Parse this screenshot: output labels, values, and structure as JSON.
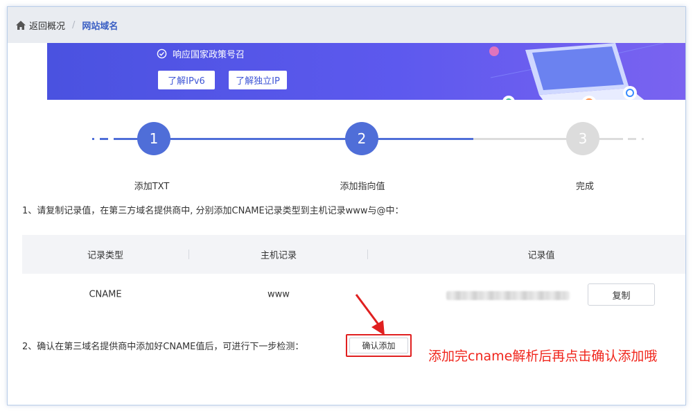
{
  "breadcrumb": {
    "back_label": "返回概况",
    "separator": "/",
    "current": "网站域名"
  },
  "banner": {
    "slogan": "响应国家政策号召",
    "btn_ipv6": "了解IPv6",
    "btn_ip": "了解独立IP"
  },
  "steps": [
    {
      "num": "1",
      "label": "添加TXT",
      "state": "done"
    },
    {
      "num": "2",
      "label": "添加指向值",
      "state": "active"
    },
    {
      "num": "3",
      "label": "完成",
      "state": "pending"
    }
  ],
  "instruction1": "1、请复制记录值，在第三方域名提供商中, 分别添加CNAME记录类型到主机记录www与@中：",
  "table": {
    "headers": [
      "记录类型",
      "主机记录",
      "记录值"
    ],
    "row": {
      "type": "CNAME",
      "host": "www",
      "copy_label": "复制"
    }
  },
  "instruction2": "2、确认在第三域名提供商中添加好CNAME值后，可进行下一步检测：",
  "confirm_label": "确认添加",
  "annotation": "添加完cname解析后再点击确认添加哦",
  "colors": {
    "primary": "#4f6ed8",
    "pending": "#dcdcdc",
    "banner": "#5d59ee",
    "annotation": "#f0251c"
  }
}
